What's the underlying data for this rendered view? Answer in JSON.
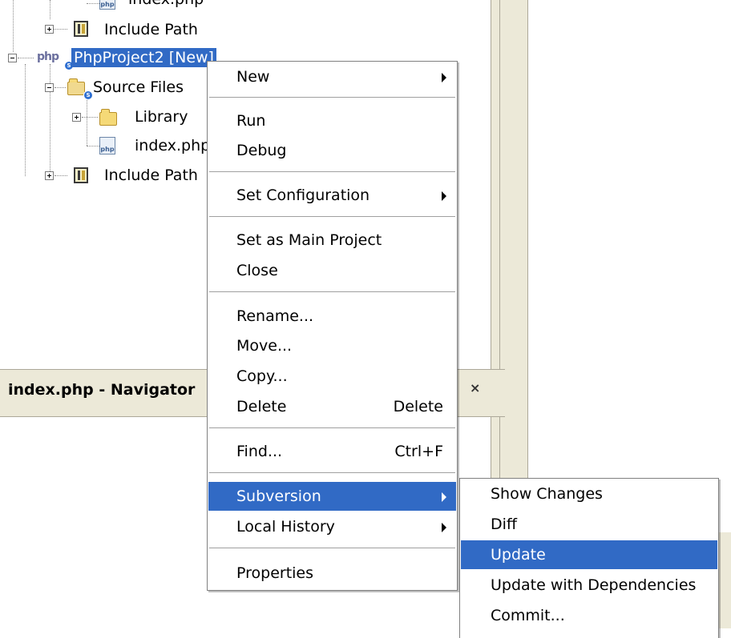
{
  "tree": {
    "partial_top_label": "index.php",
    "include_path_1": "Include Path",
    "project": "PhpProject2 [New]",
    "project_icon_text": "php",
    "source_files": "Source Files",
    "library": "Library",
    "index_file": "index.php",
    "include_path_2": "Include Path",
    "php_file_icon_text": "php",
    "svn_badge": "S"
  },
  "navigator": {
    "title": "index.php - Navigator",
    "close_glyph": "×"
  },
  "context_menu": {
    "new": "New",
    "run": "Run",
    "debug": "Debug",
    "set_configuration": "Set Configuration",
    "set_main": "Set as Main Project",
    "close": "Close",
    "rename": "Rename...",
    "move": "Move...",
    "copy": "Copy...",
    "delete": "Delete",
    "delete_shortcut": "Delete",
    "find": "Find...",
    "find_shortcut": "Ctrl+F",
    "subversion": "Subversion",
    "local_history": "Local History",
    "properties": "Properties"
  },
  "subversion_menu": {
    "show_changes": "Show Changes",
    "diff": "Diff",
    "update": "Update",
    "update_deps": "Update with Dependencies",
    "commit": "Commit..."
  },
  "colors": {
    "selection": "#316ac5",
    "panel": "#ece9d8"
  }
}
